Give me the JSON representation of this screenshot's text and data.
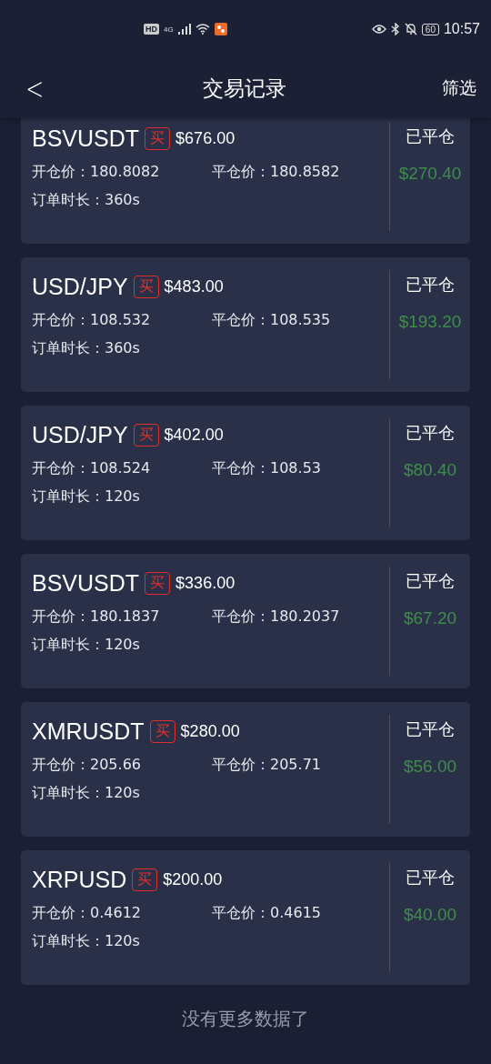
{
  "status_bar": {
    "left_badges": [
      "HD",
      "4G"
    ],
    "battery": "60",
    "time": "10:57"
  },
  "header": {
    "back": "<",
    "title": "交易记录",
    "action": "筛选"
  },
  "orders": [
    {
      "symbol": "BSVUSDT",
      "side": "买",
      "amount": "$676.00",
      "open_price": "开仓价：180.8082",
      "close_price": "平仓价：180.8582",
      "duration": "订单时长：360s",
      "status": "已平仓",
      "profit": "$270.40"
    },
    {
      "symbol": "USD/JPY",
      "side": "买",
      "amount": "$483.00",
      "open_price": "开仓价：108.532",
      "close_price": "平仓价：108.535",
      "duration": "订单时长：360s",
      "status": "已平仓",
      "profit": "$193.20"
    },
    {
      "symbol": "USD/JPY",
      "side": "买",
      "amount": "$402.00",
      "open_price": "开仓价：108.524",
      "close_price": "平仓价：108.53",
      "duration": "订单时长：120s",
      "status": "已平仓",
      "profit": "$80.40"
    },
    {
      "symbol": "BSVUSDT",
      "side": "买",
      "amount": "$336.00",
      "open_price": "开仓价：180.1837",
      "close_price": "平仓价：180.2037",
      "duration": "订单时长：120s",
      "status": "已平仓",
      "profit": "$67.20"
    },
    {
      "symbol": "XMRUSDT",
      "side": "买",
      "amount": "$280.00",
      "open_price": "开仓价：205.66",
      "close_price": "平仓价：205.71",
      "duration": "订单时长：120s",
      "status": "已平仓",
      "profit": "$56.00"
    },
    {
      "symbol": "XRPUSD",
      "side": "买",
      "amount": "$200.00",
      "open_price": "开仓价：0.4612",
      "close_price": "平仓价：0.4615",
      "duration": "订单时长：120s",
      "status": "已平仓",
      "profit": "$40.00"
    }
  ],
  "footer": "没有更多数据了"
}
